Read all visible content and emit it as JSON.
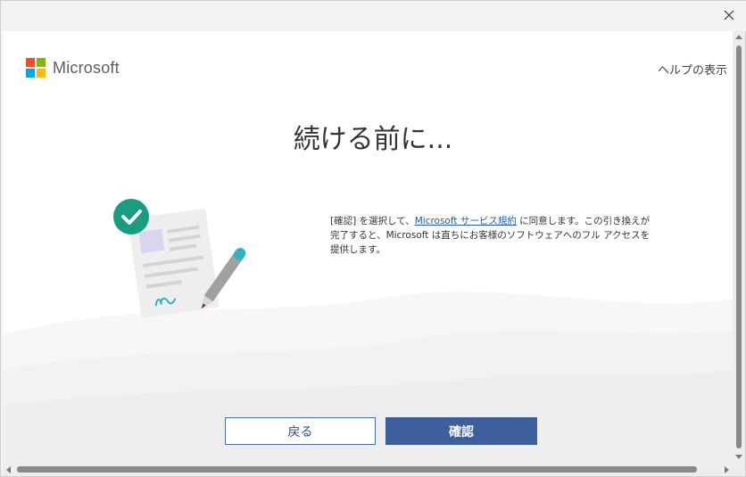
{
  "window": {
    "close_glyph": "✕"
  },
  "header": {
    "brand": "Microsoft",
    "help_link": "ヘルプの表示"
  },
  "main": {
    "heading": "続ける前に...",
    "body_prefix": "[確認] を選択して、",
    "body_link": "Microsoft サービス規約",
    "body_suffix": " に同意します。この引き換えが完了すると、Microsoft は直ちにお客様のソフトウェアへのフル アクセスを提供します。"
  },
  "buttons": {
    "back_label": "戻る",
    "confirm_label": "確認"
  },
  "colors": {
    "logo_red": "#f25022",
    "logo_green": "#7fba00",
    "logo_blue": "#00a4ef",
    "logo_yellow": "#ffb900",
    "primary_button": "#3d5f9c",
    "link": "#1f5fae"
  },
  "icons": {
    "close": "close-icon",
    "illustration": "signed-document-checkmark-illustration"
  }
}
